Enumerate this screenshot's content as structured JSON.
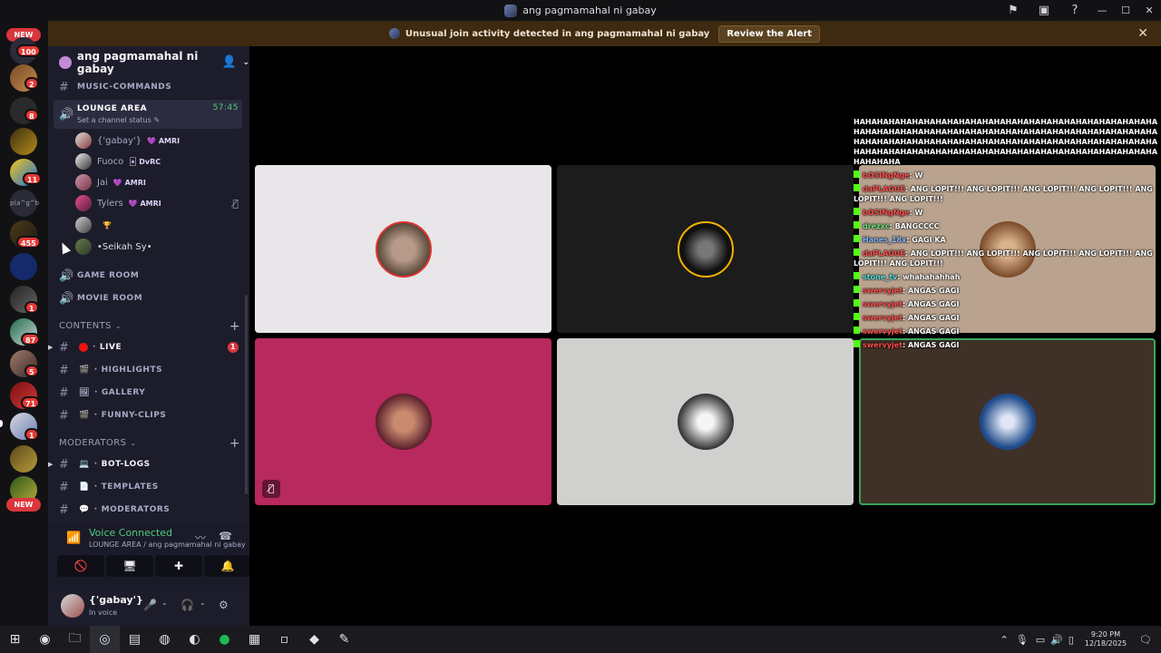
{
  "window": {
    "title": "ang pagmamahal ni gabay"
  },
  "alert": {
    "text": "Unusual join activity detected in ang pagmamahal ni gabay",
    "button": "Review the Alert"
  },
  "rail": {
    "new_top": "NEW",
    "new_bottom": "NEW",
    "badges": [
      "100",
      "2",
      "8",
      "11",
      "455",
      "1",
      "87",
      "5",
      "71",
      "1"
    ],
    "glyph_label": "p(a^g^b"
  },
  "server": {
    "name": "ang pagmamahal ni gabay"
  },
  "channels_top": [
    {
      "label": "MUSIC-COMMANDS"
    },
    {
      "label": "LOUNGE AREA",
      "status": "Set a channel status",
      "timer": "57:45"
    }
  ],
  "voice_users": [
    {
      "name": "{'gabay'}",
      "tag": "AMRI"
    },
    {
      "name": "Fuoco",
      "tag": "DvRC"
    },
    {
      "name": "Jai",
      "tag": "AMRI"
    },
    {
      "name": "Tylers",
      "tag": "AMRI"
    },
    {
      "name": "",
      "tag": "🏆"
    },
    {
      "name": "•Seikah Sy•",
      "tag": ""
    }
  ],
  "channels_mid": [
    {
      "label": "GAME ROOM"
    },
    {
      "label": "MOVIE ROOM"
    }
  ],
  "categories": {
    "contents": "CONTENTS",
    "moderators": "MODERATORS"
  },
  "contents_channels": [
    {
      "label": "LIVE",
      "badge": "1"
    },
    {
      "label": "HIGHLIGHTS"
    },
    {
      "label": "GALLERY"
    },
    {
      "label": "FUNNY-CLIPS"
    }
  ],
  "moderator_channels": [
    {
      "label": "BOT-LOGS"
    },
    {
      "label": "TEMPLATES"
    },
    {
      "label": "MODERATORS"
    }
  ],
  "voice_connection": {
    "title": "Voice Connected",
    "subtitle": "LOUNGE AREA / ang pagmamahal ni gabay"
  },
  "user": {
    "name": "{'gabay'}",
    "status": "In voice"
  },
  "overlay_chat": {
    "spam": "HAHAHAHAHAHAHAHAHAHAHAHAHAHAHAHAHAHAHAHAHAHAHAHAHAHAHAHAHAHAHAHAHAHAHAHAHAHAHAHAHAHAHAHAHAHAHAHAHAHAHAHAHAHAHAHAHAHAHAHAHAHAHAHAHAHAHAHAHAHAHAHAHAHAHAHAHAHAHAHAHAHAHAHAHAHAHAHAHAHAHAHAHAHAHAHAHAHAHAHAHAHAHAHAHAHAHAHA",
    "messages": [
      {
        "user": "bOSINgNge",
        "text": ": W",
        "color": "red"
      },
      {
        "user": "daPLAGUE",
        "text": ": ANG LOPIT!!! ANG LOPIT!!! ANG LOPIT!!! ANG LOPIT!!! ANG LOPIT!!! ANG LOPIT!!!",
        "color": "red"
      },
      {
        "user": "bOSINgNge",
        "text": ": W",
        "color": "red"
      },
      {
        "user": "drezxc",
        "text": ": BANGCCCC",
        "color": "green"
      },
      {
        "user": "Hanes_18x",
        "text": ": GAGI KA",
        "color": "blue"
      },
      {
        "user": "daPLAGUE",
        "text": ": ANG LOPIT!!! ANG LOPIT!!! ANG LOPIT!!! ANG LOPIT!!! ANG LOPIT!!! ANG LOPIT!!!",
        "color": "red"
      },
      {
        "user": "stone_tv",
        "text": ": whahahahhah",
        "color": "cyan"
      },
      {
        "user": "swervyjet",
        "text": ": ANGAS GAGI",
        "color": "red"
      },
      {
        "user": "swervyjet",
        "text": ": ANGAS GAGI",
        "color": "red"
      },
      {
        "user": "swervyjet",
        "text": ": ANGAS GAGI",
        "color": "red"
      },
      {
        "user": "swervyjet",
        "text": ": ANGAS GAGI",
        "color": "red"
      },
      {
        "user": "swervyjet",
        "text": ": ANGAS GAGI",
        "color": "red"
      }
    ]
  },
  "tiles": [
    {
      "bg": "#e8e6e8"
    },
    {
      "bg": "#1c1c1c"
    },
    {
      "bg": "#b9a38f"
    },
    {
      "bg": "#b8295e"
    },
    {
      "bg": "#d0d0ce"
    },
    {
      "bg": "#3f3128"
    }
  ],
  "taskbar": {
    "time": "9:20 PM",
    "date": "12/18/2025"
  },
  "colors": {
    "accent_green": "#4fcc7c",
    "alert_bg": "#3d2a10",
    "sidebar_bg": "#1c1c2b"
  }
}
